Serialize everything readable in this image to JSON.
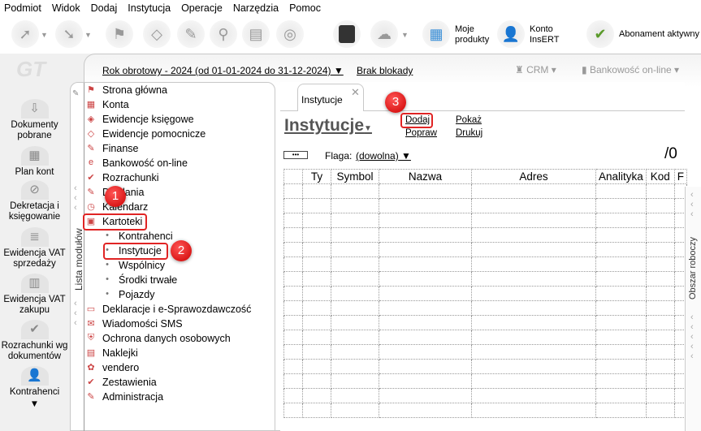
{
  "menu": [
    "Podmiot",
    "Widok",
    "Dodaj",
    "Instytucja",
    "Operacje",
    "Narzędzia",
    "Pomoc"
  ],
  "toolbar": {
    "moje_produkty_1": "Moje",
    "moje_produkty_2": "produkty",
    "konto_1": "Konto",
    "konto_2": "InsERT",
    "abonament": "Abonament aktywny"
  },
  "logo": "GT",
  "header": {
    "rok": "Rok obrotowy - 2024  (od 01-01-2024 do 31-12-2024)",
    "blokada": "Brak blokady",
    "crm": "CRM",
    "bankowosc": "Bankowość on-line"
  },
  "leftbar": [
    "Dokumenty pobrane",
    "Plan kont",
    "Dekretacja i księgowanie",
    "Ewidencja VAT sprzedaży",
    "Ewidencja VAT zakupu",
    "Rozrachunki wg dokumentów",
    "Kontrahenci"
  ],
  "tree_label": "Lista modułów",
  "tree": [
    {
      "label": "Strona główna"
    },
    {
      "label": "Konta"
    },
    {
      "label": "Ewidencje księgowe"
    },
    {
      "label": "Ewidencje pomocnicze"
    },
    {
      "label": "Finanse"
    },
    {
      "label": "Bankowość on-line"
    },
    {
      "label": "Rozrachunki"
    },
    {
      "label": "Działania"
    },
    {
      "label": "Kalendarz"
    },
    {
      "label": "Kartoteki"
    },
    {
      "label": "Kontrahenci",
      "sub": true
    },
    {
      "label": "Instytucje",
      "sub": true
    },
    {
      "label": "Wspólnicy",
      "sub": true
    },
    {
      "label": "Środki trwałe",
      "sub": true
    },
    {
      "label": "Pojazdy",
      "sub": true
    },
    {
      "label": "Deklaracje i e-Sprawozdawczość"
    },
    {
      "label": "Wiadomości SMS"
    },
    {
      "label": "Ochrona danych osobowych"
    },
    {
      "label": "Naklejki"
    },
    {
      "label": "vendero"
    },
    {
      "label": "Zestawienia"
    },
    {
      "label": "Administracja"
    }
  ],
  "badges": [
    "1",
    "2",
    "3"
  ],
  "content": {
    "tab": "Instytucje",
    "title": "Instytucje",
    "actions": {
      "dodaj": "Dodaj",
      "popraw": "Popraw",
      "pokaz": "Pokaż",
      "drukuj": "Drukuj"
    },
    "dots": "•••",
    "flaga_label": "Flaga:",
    "flaga_value": "(dowolna)",
    "count": "/0",
    "columns": [
      "",
      "Ty",
      "Symbol",
      "Nazwa",
      "Adres",
      "Analityka",
      "Kod",
      "F"
    ]
  },
  "right_label": "Obszar roboczy"
}
